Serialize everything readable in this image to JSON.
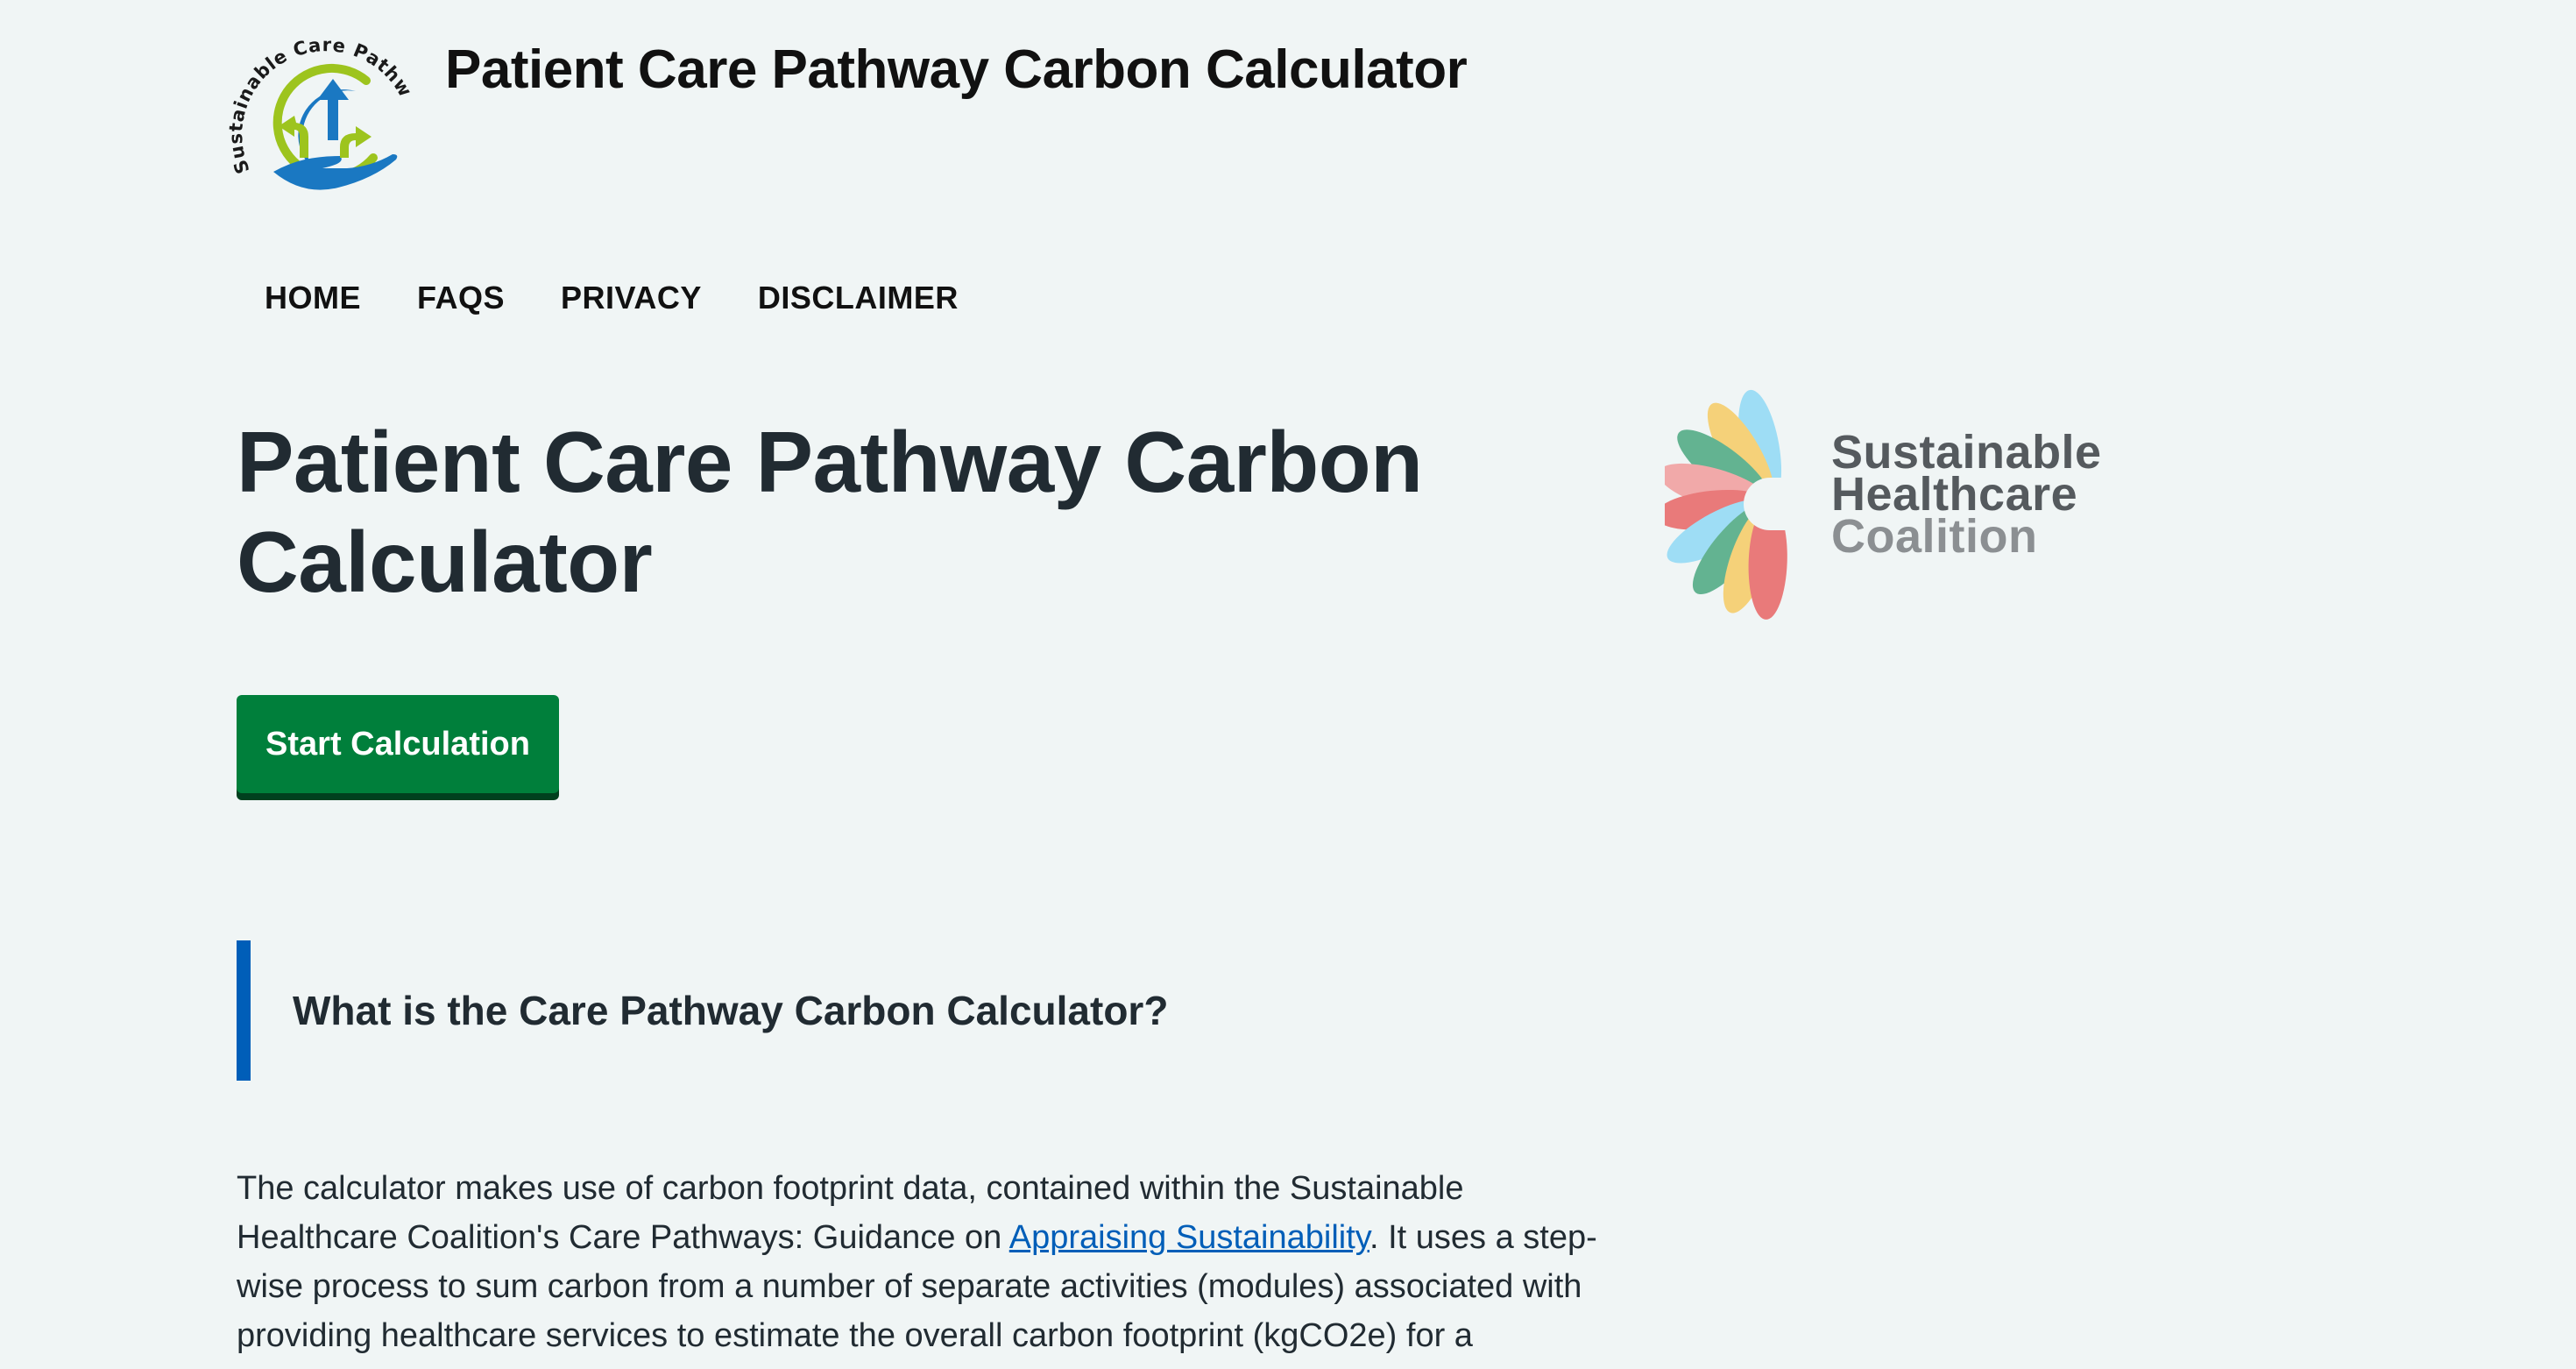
{
  "header": {
    "logo_name": "Sustainable Care Pathways",
    "title": "Patient Care Pathway Carbon Calculator"
  },
  "nav": {
    "items": [
      {
        "label": "HOME"
      },
      {
        "label": "FAQS"
      },
      {
        "label": "PRIVACY"
      },
      {
        "label": "DISCLAIMER"
      }
    ]
  },
  "hero": {
    "title": "Patient Care Pathway Carbon Calculator",
    "start_button_label": "Start Calculation"
  },
  "partner": {
    "line1": "Sustainable",
    "line2": "Healthcare",
    "line3": "Coalition"
  },
  "callout": {
    "title": "What is the Care Pathway Carbon Calculator?"
  },
  "intro": {
    "text_before_link": "The calculator makes use of carbon footprint data, contained within the Sustainable Healthcare Coalition's Care Pathways: Guidance on ",
    "link_text": "Appraising Sustainability",
    "text_after_link": ". It uses a step-wise process to sum carbon from a number of separate activities (modules) associated with providing healthcare services to estimate the overall carbon footprint (kgCO2e) for a"
  },
  "colors": {
    "background": "#f0f5f5",
    "button_green": "#007f3b",
    "link_blue": "#005eb8",
    "callout_bar": "#005eb8"
  }
}
